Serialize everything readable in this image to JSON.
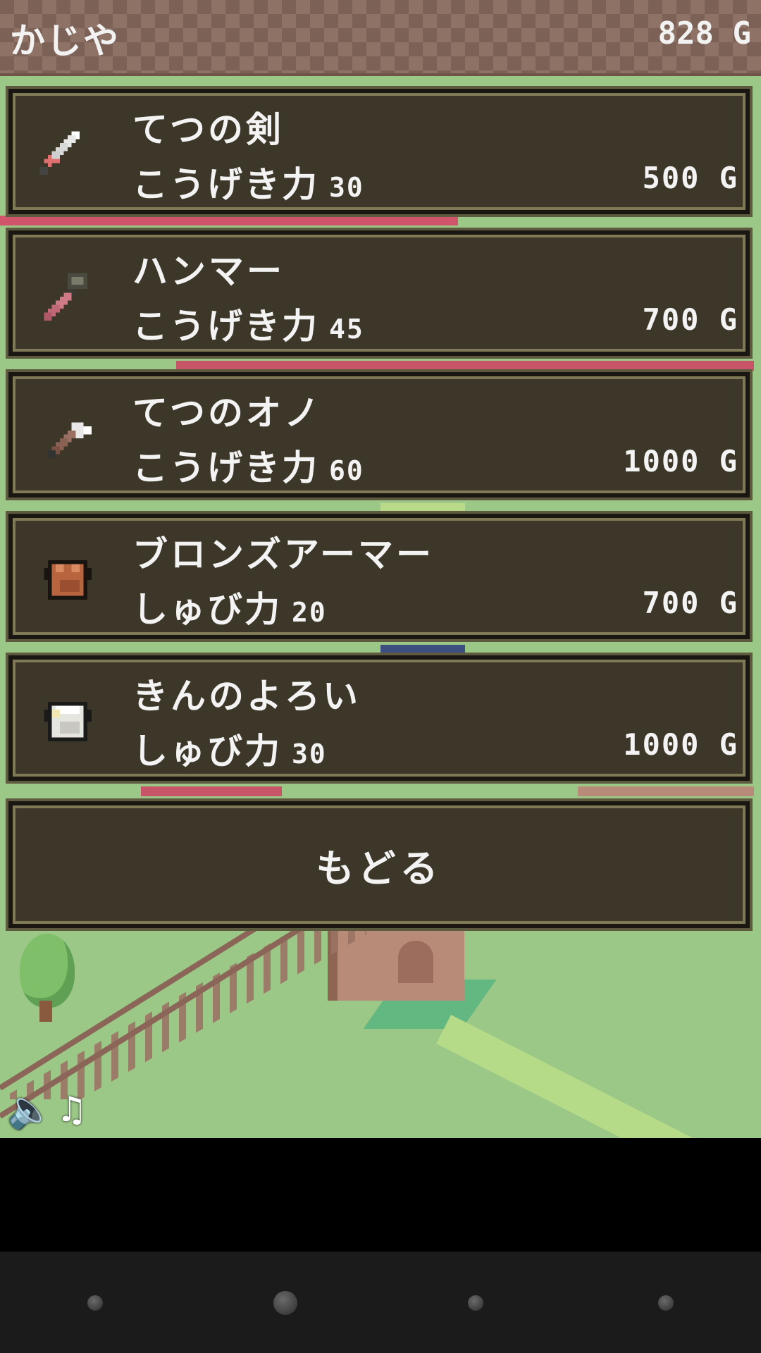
{
  "shop": {
    "title": "かじや",
    "gold": "828 G"
  },
  "items": [
    {
      "name": "てつの剣",
      "icon": "sword-icon",
      "stat_label": "こうげき力",
      "stat_value": "30",
      "price": "500 G"
    },
    {
      "name": "ハンマー",
      "icon": "hammer-icon",
      "stat_label": "こうげき力",
      "stat_value": "45",
      "price": "700 G"
    },
    {
      "name": "てつのオノ",
      "icon": "axe-icon",
      "stat_label": "こうげき力",
      "stat_value": "60",
      "price": "1000 G"
    },
    {
      "name": "ブロンズアーマー",
      "icon": "bronze-armor-icon",
      "stat_label": "しゅび力",
      "stat_value": "20",
      "price": "700 G"
    },
    {
      "name": "きんのよろい",
      "icon": "gold-armor-icon",
      "stat_label": "しゅび力",
      "stat_value": "30",
      "price": "1000 G"
    }
  ],
  "back_label": "もどる",
  "controls": {
    "sound_icon": "speaker-icon",
    "music_icon": "music-note-icon"
  },
  "colors": {
    "panel": "#3d3729",
    "panel_border": "#7f7a55",
    "grass": "#9bc887",
    "topbar": "#8d7265"
  }
}
